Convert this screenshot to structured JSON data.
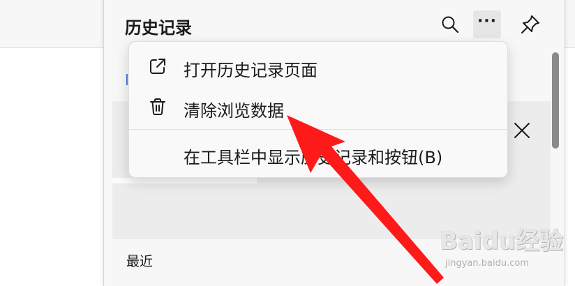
{
  "panel": {
    "title": "历史记录",
    "header_buttons": [
      {
        "icon": "search-icon"
      },
      {
        "icon": "more-icon",
        "label": "···"
      },
      {
        "icon": "pin-icon"
      }
    ]
  },
  "menu": {
    "items": [
      {
        "icon": "external-link-icon",
        "label": "打开历史记录页面"
      },
      {
        "icon": "trash-icon",
        "label": "清除浏览数据"
      },
      {
        "icon": "",
        "label": "在工具栏中显示历史记录和按钮(B)"
      }
    ]
  },
  "content": {
    "recent_label": "最近"
  },
  "annotation": {
    "arrow_color": "#ff1a1a"
  },
  "watermark": {
    "brand": "Baidu经验",
    "url": "jingyan.baidu.com"
  }
}
